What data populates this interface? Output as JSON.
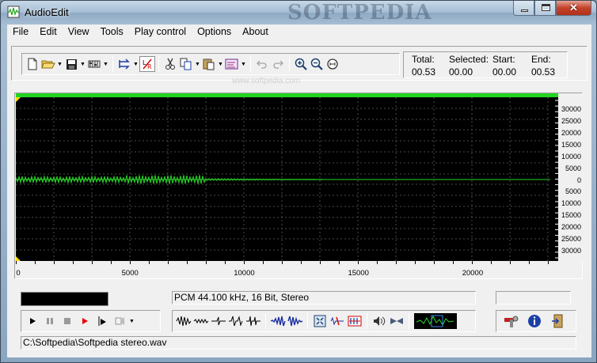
{
  "window": {
    "title": "AudioEdit",
    "watermark": "SOFTPEDIA"
  },
  "menu": {
    "items": [
      "File",
      "Edit",
      "View",
      "Tools",
      "Play control",
      "Options",
      "About"
    ]
  },
  "toolbar": {
    "url_watermark": "www.softpedia.com",
    "icons": [
      "new-file-icon",
      "open-folder-icon",
      "save-icon",
      "mixer-icon",
      "swap-channels-icon",
      "channel-select-icon",
      "cut-icon",
      "copy-icon",
      "paste-icon",
      "paste-special-icon",
      "undo-icon",
      "redo-icon",
      "zoom-in-icon",
      "zoom-out-icon",
      "zoom-fit-icon"
    ]
  },
  "stats": {
    "total_label": "Total:",
    "total_value": "00.53",
    "selected_label": "Selected:",
    "selected_value": "00.00",
    "start_label": "Start:",
    "start_value": "00.00",
    "end_label": "End:",
    "end_value": "00.53"
  },
  "waveform": {
    "y_labels": [
      "30000",
      "25000",
      "20000",
      "15000",
      "10000",
      "5000",
      "0",
      "5000",
      "10000",
      "15000",
      "20000",
      "25000",
      "30000"
    ],
    "x_labels": [
      "0",
      "5000",
      "10000",
      "15000",
      "20000"
    ],
    "x_max_samples": 23400,
    "signal_end_sample": 13500,
    "colors": {
      "background": "#000000",
      "wave": "#2ad62a",
      "grid": "#4a4a4a"
    }
  },
  "playback": {
    "format": "PCM 44.100 kHz, 16 Bit, Stereo"
  },
  "status": {
    "path": "C:\\Softpedia\\Softpedia stereo.wav"
  }
}
